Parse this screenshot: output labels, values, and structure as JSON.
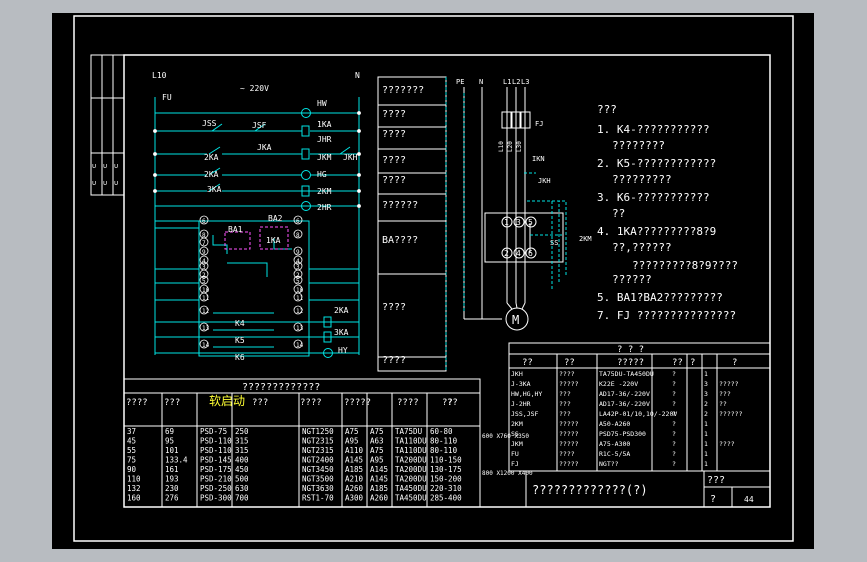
{
  "circuit": {
    "l10": "L10",
    "n": "N",
    "fu": "FU",
    "voltage": "~ 220V",
    "hw": "HW",
    "ka1": "1KA",
    "jhr": "JHR",
    "jkm": "JKM",
    "jkh": "JKH",
    "hg": "HG",
    "km2": "2KM",
    "hr2": "2HR",
    "hy": "HY",
    "ss": "JSS",
    "sf": "JSF",
    "ka1b": "JKA",
    "ka2": "2KA",
    "ka2b": "2KA",
    "ka3": "3KA",
    "ba1": "BA1",
    "ba2": "BA2",
    "ka1c": "1KA",
    "k4": "K4",
    "k5": "K5",
    "k6": "K6",
    "ka2c": "2KA",
    "ka3b": "3KA",
    "terms": [
      "6",
      "8",
      "7",
      "9",
      "4",
      "3",
      "2",
      "5",
      "10",
      "11",
      "12",
      "13",
      "14"
    ],
    "terms_r": [
      "6",
      "8",
      "9",
      "4",
      "3",
      "2",
      "5",
      "10",
      "11",
      "12",
      "13",
      "14"
    ]
  },
  "func_boxes": [
    "???????",
    "????",
    "????",
    "????",
    "????",
    "??????",
    "BA????",
    "????",
    "????"
  ],
  "power": {
    "pe": "PE",
    "n": "N",
    "l1": "L1",
    "l2": "L2",
    "l3": "L3",
    "fj": "FJ",
    "f1": "L10",
    "f2": "L20",
    "f3": "L30",
    "ikn": "IKN",
    "jkh": "JKH",
    "km2": "2KM",
    "ss": "SS",
    "motor": "M",
    "nodes": [
      "1",
      "3",
      "5",
      "2",
      "4",
      "6"
    ]
  },
  "notes": {
    "title": "???",
    "items": [
      "1. K4-???????????",
      "????????",
      "2. K5-????????????",
      "?????????",
      "3. K6-???????????",
      "??",
      "4. 1KA?????????8?9",
      "??,??????",
      "?????????8?9????",
      "??????",
      "5. BA1?BA2?????????",
      "7. FJ    ???????????????"
    ]
  },
  "selection_table": {
    "title": "?????????????",
    "headers": [
      "????",
      "???",
      "软启动",
      "???",
      "????",
      "?????",
      "????",
      "??",
      "??"
    ],
    "sub": [
      "(kw)",
      "(A)",
      "软启动器",
      "(A)",
      "???",
      "??",
      "??",
      "??",
      "??",
      "(A)",
      "(mm)"
    ],
    "rows": [
      [
        "37",
        "69",
        "PSD-75",
        "250",
        "NGT1250",
        "A75",
        "A75",
        "TA75DU",
        "60-80"
      ],
      [
        "45",
        "95",
        "PSD-110",
        "315",
        "NGT2315",
        "A95",
        "A63",
        "TA110DU",
        "80-110"
      ],
      [
        "55",
        "101",
        "PSD-110",
        "315",
        "NGT2315",
        "A110",
        "A75",
        "TA110DU",
        "80-110"
      ],
      [
        "75",
        "133.4",
        "PSD-145",
        "400",
        "NGT2400",
        "A145",
        "A95",
        "TA200DU",
        "110-150"
      ],
      [
        "90",
        "161",
        "PSD-175",
        "450",
        "NGT3450",
        "A185",
        "A145",
        "TA200DU",
        "130-175"
      ],
      [
        "110",
        "193",
        "PSD-210",
        "500",
        "NGT3500",
        "A210",
        "A145",
        "TA200DU",
        "150-200"
      ],
      [
        "132",
        "230",
        "PSD-250",
        "630",
        "NGT3630",
        "A260",
        "A185",
        "TA450DU",
        "220-310"
      ],
      [
        "160",
        "276",
        "PSD-300",
        "700",
        "RST1-70",
        "A300",
        "A260",
        "TA450DU",
        "285-400"
      ]
    ],
    "dims": [
      "600\nX760\nX350",
      "800\nX1200\nX400"
    ]
  },
  "component_table": {
    "title": "? ? ?",
    "headers": [
      "??",
      "??",
      "?????",
      "??",
      "?",
      "?"
    ],
    "rows": [
      [
        "JKH",
        "????",
        "TA75DU-TA450DU",
        "?",
        "1",
        ""
      ],
      [
        "J-3KA",
        "?????",
        "K22E -220V",
        "?",
        "3",
        "?????"
      ],
      [
        "HW,HG,HY",
        "???",
        "AD17-36/-220V",
        "?",
        "3",
        "???"
      ],
      [
        "J-2HR",
        "???",
        "AD17-36/-220V",
        "?",
        "2",
        "??"
      ],
      [
        "JSS,JSF",
        "???",
        "LA42P-01/10,10/-220V",
        "?",
        "2",
        "??????"
      ],
      [
        "2KM",
        "?????",
        "A50-A260",
        "?",
        "1",
        ""
      ],
      [
        "SS",
        "?????",
        "PSD75-PSD300",
        "?",
        "1",
        ""
      ],
      [
        "JKM",
        "?????",
        "A75-A300",
        "?",
        "1",
        "????"
      ],
      [
        "FU",
        "????",
        "R1C-5/5A",
        "?",
        "1",
        ""
      ],
      [
        "FJ",
        "?????",
        "NGT??",
        "?",
        "1",
        ""
      ]
    ]
  },
  "title_block": {
    "name": "?????????????(?)",
    "code": "???",
    "sheet": "?",
    "page": "44"
  }
}
